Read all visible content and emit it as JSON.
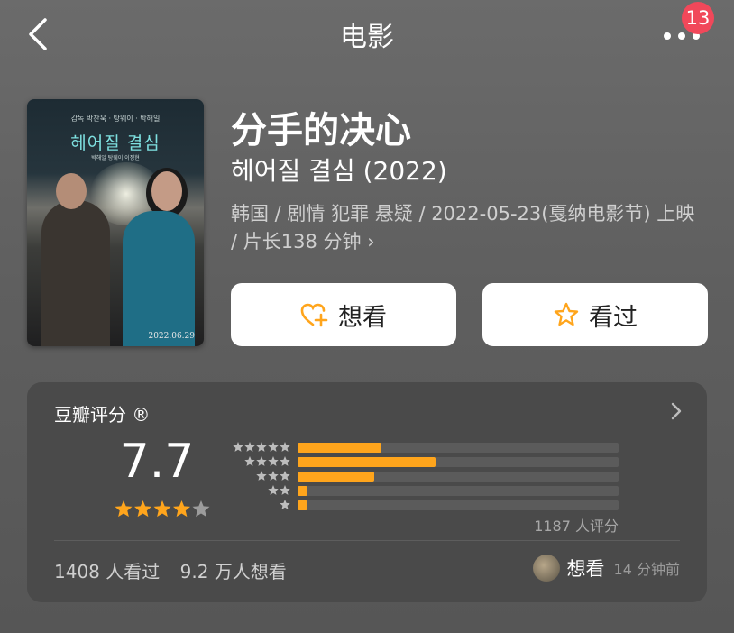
{
  "nav": {
    "title": "电影",
    "badge": "13"
  },
  "movie": {
    "title": "分手的决心",
    "original_title": "헤어질 결심 (2022)",
    "meta": "韩国 / 剧情 犯罪 悬疑 / 2022-05-23(戛纳电影节) 上映 / 片长138 分钟",
    "meta_chevron": "›"
  },
  "poster": {
    "top_text": "감독 박찬욱 · 탕웨이 · 박해일",
    "title": "헤어질 결심",
    "credits": "박해일 탕웨이 이정현",
    "date": "2022.06.29"
  },
  "actions": {
    "want_label": "想看",
    "seen_label": "看过"
  },
  "rating": {
    "title": "豆瓣评分 ®",
    "score": "7.7",
    "star_fill": 4,
    "distribution": [
      {
        "stars": 5,
        "fraction": 0.26
      },
      {
        "stars": 4,
        "fraction": 0.43
      },
      {
        "stars": 3,
        "fraction": 0.24
      },
      {
        "stars": 2,
        "fraction": 0.03
      },
      {
        "stars": 1,
        "fraction": 0.03
      }
    ],
    "raters": "1187 人评分",
    "seen_count": "1408 人看过",
    "want_count": "9.2 万人想看",
    "friend_action": "想看",
    "friend_time": "14 分钟前"
  },
  "colors": {
    "accent": "#ffa51c",
    "badge": "#f1485a",
    "star_empty": "#9c9c9c",
    "dist_star": "#bdbdbd"
  },
  "icons": {
    "back": "chevron-left-icon",
    "more": "more-dots-icon",
    "want": "heart-plus-icon",
    "seen": "star-outline-icon",
    "card_arrow": "chevron-right-icon"
  }
}
